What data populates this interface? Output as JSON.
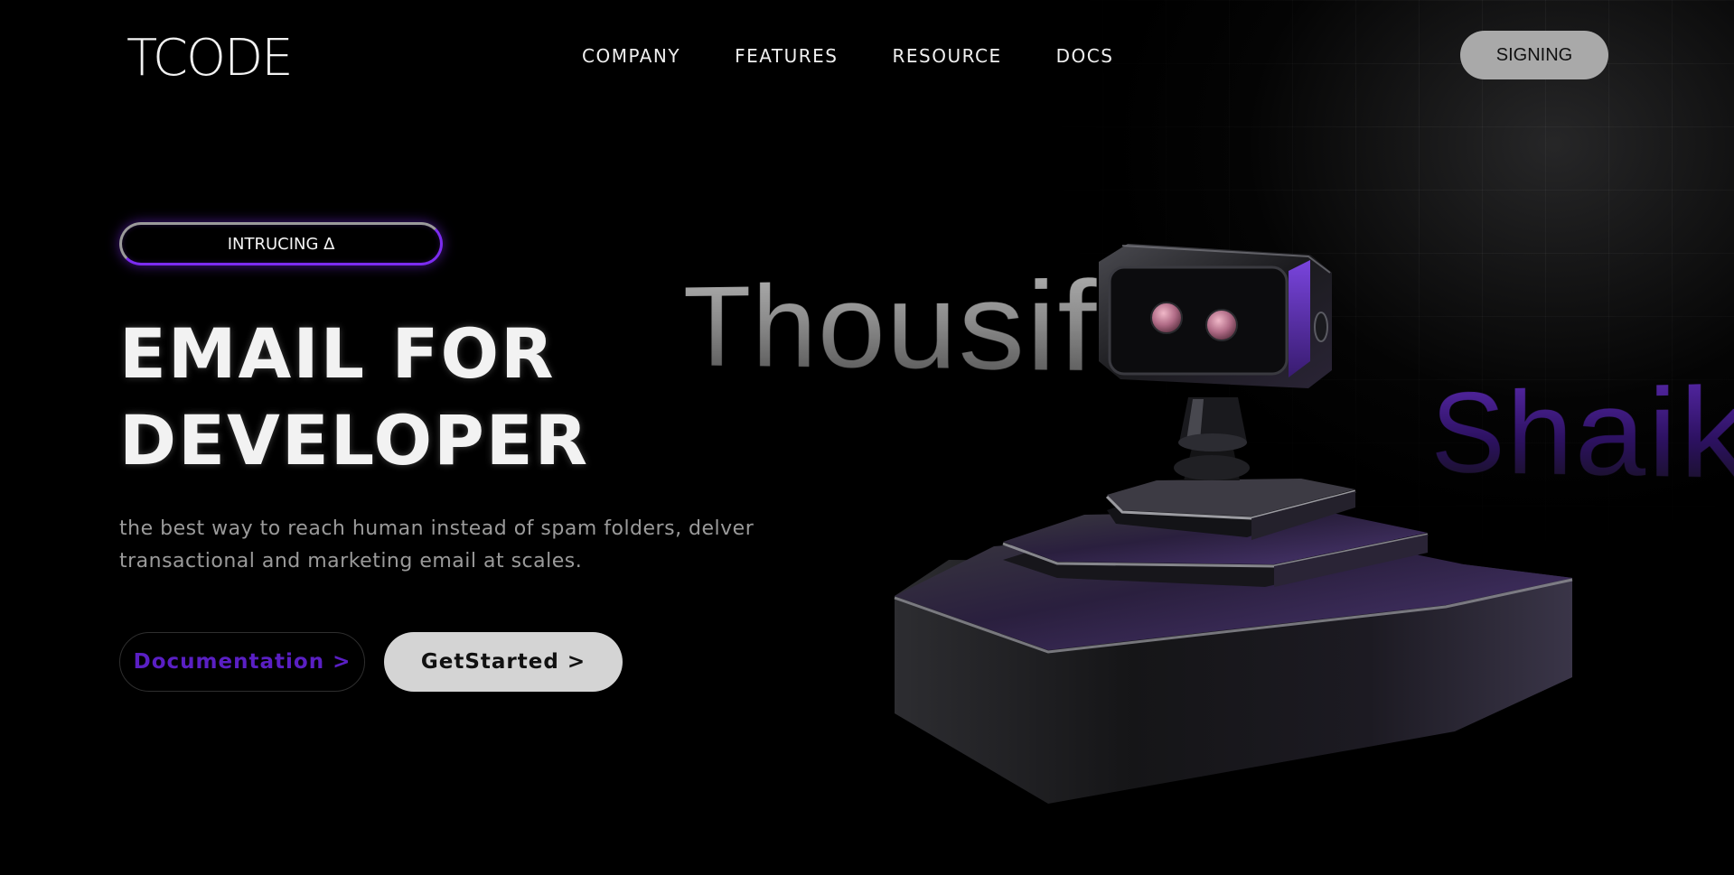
{
  "header": {
    "logo": "TCODE",
    "nav": [
      "COMPANY",
      "FEATURES",
      "RESOURCE",
      "DOCS"
    ],
    "signin_label": "SIGNING"
  },
  "hero": {
    "badge": "INTRUCING ∆",
    "title_line1": "EMAIL FOR",
    "title_line2": "DEVELOPER",
    "description": "the best way to reach human instead of spam folders, delver transactional and marketing email at scales.",
    "doc_button": "Documentation >",
    "start_button": "GetStarted >"
  },
  "floating_text": {
    "first": "Thousif",
    "second": "Shaik"
  },
  "colors": {
    "background": "#000000",
    "accent_purple": "#7c2cf0",
    "doc_text": "#5a1fc4",
    "signin_bg": "#a9a9a9",
    "start_bg": "#d4d4d4"
  },
  "illustration": {
    "icon": "robot-on-pedestal-3d"
  }
}
